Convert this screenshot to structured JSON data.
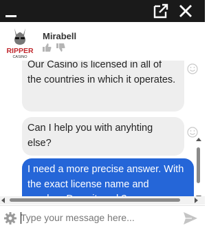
{
  "window": {
    "popout_icon": "popout-icon",
    "close_icon": "close-icon"
  },
  "header": {
    "agent_name": "Mirabell",
    "logo": {
      "line1": "RIPPER",
      "line2": "CASINO"
    }
  },
  "messages": [
    {
      "sender": "bot",
      "text": "Our Casino is licensed in all of the countries in which it operates."
    },
    {
      "sender": "bot",
      "text": "Can I help you with anyhting else?"
    },
    {
      "sender": "user",
      "text": "I need a more precise answer. With the exact license name and number. Does it work?"
    }
  ],
  "composer": {
    "placeholder": "Type your message here..."
  },
  "colors": {
    "titlebar": "#1a1a1a",
    "user_bubble": "#2566d8",
    "bot_bubble": "#eeeeee",
    "logo_red": "#c0272d"
  }
}
